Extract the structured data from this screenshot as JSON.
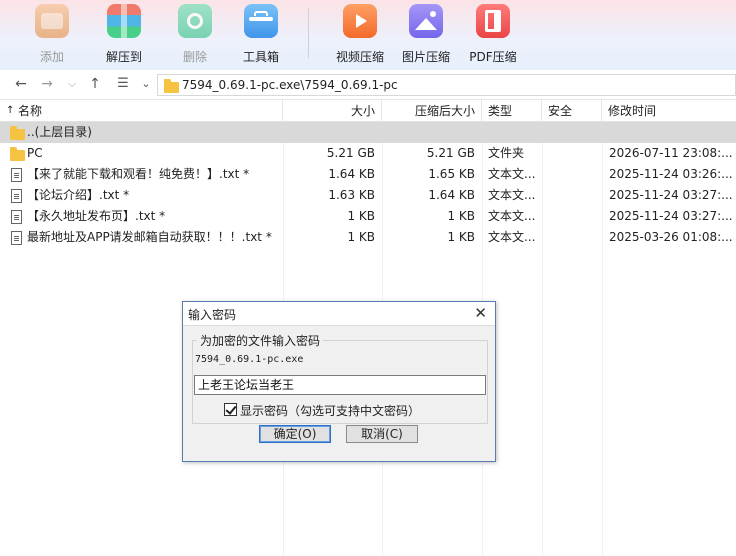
{
  "toolbar": {
    "buttons": [
      {
        "label": "添加",
        "icon": "add-archive-icon",
        "disabled": true,
        "color": "#e79a52"
      },
      {
        "label": "解压到",
        "icon": "extract-to-icon",
        "disabled": false,
        "color": "#4aa6e3"
      },
      {
        "label": "删除",
        "icon": "delete-recycle-icon",
        "disabled": true,
        "color": "#4ccf9a"
      },
      {
        "label": "工具箱",
        "icon": "toolbox-icon",
        "disabled": false,
        "color": "#55a9f0"
      },
      {
        "label": "视频压缩",
        "icon": "video-compress-icon",
        "disabled": false,
        "color": "#f57d3b"
      },
      {
        "label": "图片压缩",
        "icon": "image-compress-icon",
        "disabled": false,
        "color": "#8b7cf0"
      },
      {
        "label": "PDF压缩",
        "icon": "pdf-compress-icon",
        "disabled": false,
        "color": "#f05a5a"
      }
    ]
  },
  "address": {
    "path": "7594_0.69.1-pc.exe\\7594_0.69.1-pc"
  },
  "columns": {
    "name": "名称",
    "size": "大小",
    "packed": "压缩后大小",
    "type": "类型",
    "security": "安全",
    "modified": "修改时间"
  },
  "parent_row": "..(上层目录)",
  "files": [
    {
      "name": "PC",
      "size": "5.21 GB",
      "packed": "5.21 GB",
      "type": "文件夹",
      "modified": "2026-07-11 23:08:...",
      "is_folder": true
    },
    {
      "name": "【来了就能下载和观看！纯免费！】.txt *",
      "size": "1.64 KB",
      "packed": "1.65 KB",
      "type": "文本文...",
      "modified": "2025-11-24 03:26:...",
      "is_folder": false
    },
    {
      "name": "【论坛介绍】.txt *",
      "size": "1.63 KB",
      "packed": "1.64 KB",
      "type": "文本文...",
      "modified": "2025-11-24 03:27:...",
      "is_folder": false
    },
    {
      "name": "【永久地址发布页】.txt *",
      "size": "1 KB",
      "packed": "1 KB",
      "type": "文本文...",
      "modified": "2025-11-24 03:27:...",
      "is_folder": false
    },
    {
      "name": "最新地址及APP请发邮箱自动获取！！！.txt *",
      "size": "1 KB",
      "packed": "1 KB",
      "type": "文本文...",
      "modified": "2025-03-26 01:08:...",
      "is_folder": false
    }
  ],
  "dialog": {
    "title": "输入密码",
    "group_label": "为加密的文件输入密码",
    "filename": "7594_0.69.1-pc.exe",
    "password_value": "上老王论坛当老王",
    "show_password_label": "显示密码（勾选可支持中文密码）",
    "show_password_checked": true,
    "ok_label": "确定(O)",
    "cancel_label": "取消(C)"
  }
}
